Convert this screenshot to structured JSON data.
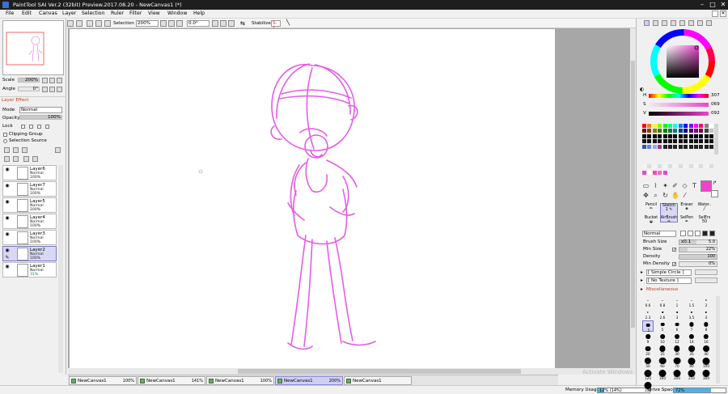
{
  "window": {
    "title": "PaintTool SAI Ver.2 (32bit) Preview.2017.08.20 - NewCanvas1 (*)",
    "min": "–",
    "max": "□",
    "close": "✕"
  },
  "menu": [
    "File",
    "Edit",
    "Canvas",
    "Layer",
    "Selection",
    "Ruler",
    "Filter",
    "View",
    "Window",
    "Help"
  ],
  "toolbar": {
    "selection_label": "Selection",
    "zoom": "200%",
    "angle": "0.0°",
    "stabilizer_label": "Stabilizer",
    "stabilizer_value": "S-1"
  },
  "navigator": {
    "scale_label": "Scale",
    "scale_value": "200%",
    "angle_label": "Angle",
    "angle_value": "0°"
  },
  "layer_panel": {
    "effect_label": "Layer Effect",
    "mode_label": "Mode",
    "mode_value": "Normal",
    "opacity_label": "Opacity",
    "opacity_value": "100%",
    "lock_label": "Lock",
    "clipping_label": "Clipping Group",
    "selection_source_label": "Selection Source",
    "layers": [
      {
        "name": "Layer6",
        "mode": "Normal",
        "opacity": "100%"
      },
      {
        "name": "Layer7",
        "mode": "Normal",
        "opacity": "100%"
      },
      {
        "name": "Layer5",
        "mode": "Normal",
        "opacity": "100%"
      },
      {
        "name": "Layer4",
        "mode": "Normal",
        "opacity": "100%"
      },
      {
        "name": "Layer3",
        "mode": "Normal",
        "opacity": "100%"
      },
      {
        "name": "Layer2",
        "mode": "Normal",
        "opacity": "100%"
      },
      {
        "name": "Layer1",
        "mode": "Normal",
        "opacity": "31%"
      }
    ]
  },
  "canvas_tabs": [
    {
      "name": "NewCanvas1",
      "zoom": "100%"
    },
    {
      "name": "NewCanvas1",
      "zoom": "141%"
    },
    {
      "name": "NewCanvas1",
      "zoom": "100%"
    },
    {
      "name": "NewCanvas1",
      "zoom": "200%"
    },
    {
      "name": "NewCanvas1",
      "zoom": ""
    }
  ],
  "status": {
    "memory_label": "Memory Usage",
    "memory_value": "12% (14%)",
    "memory_fraction": 0.12,
    "drive_label": "Drive Space",
    "drive_value": "72%",
    "drive_fraction": 0.72,
    "activate_text": "Activate Windows"
  },
  "color": {
    "current": "#ee44cc",
    "h_label": "H",
    "h_value": "307",
    "s_label": "S",
    "s_value": "069",
    "v_label": "V",
    "v_value": "092"
  },
  "tools": [
    {
      "name": "Pencil",
      "size": ""
    },
    {
      "name": "Sketch",
      "size": "1"
    },
    {
      "name": "Eraser",
      "size": ""
    },
    {
      "name": "Water..",
      "size": ""
    },
    {
      "name": "Bucket",
      "size": ""
    },
    {
      "name": "AirBrush",
      "size": ""
    },
    {
      "name": "SelPen",
      "size": ""
    },
    {
      "name": "SelErs",
      "size": "50"
    }
  ],
  "brush": {
    "mode_value": "Normal",
    "size_label": "Brush Size",
    "size_mult": "x0.1",
    "size_value": "5.0",
    "minsize_label": "Min Size",
    "minsize_value": "22%",
    "density_label": "Density",
    "density_value": "100",
    "mindensity_label": "Min Density",
    "mindensity_value": "0%",
    "shape_value": "[ Simple Circle ]",
    "texture_value": "[ No Texture ]",
    "misc_label": "Miscellaneous"
  },
  "brush_sizes": [
    "0.6",
    "0.8",
    "1",
    "1.5",
    "2",
    "2.3",
    "2.6",
    "3",
    "3.5",
    "4",
    "5",
    "5",
    "6",
    "7",
    "8",
    "9",
    "10",
    "12",
    "14",
    "16",
    "20",
    "25",
    "30",
    "35",
    "40",
    "50",
    "60",
    "70",
    "80",
    "100",
    "120",
    "160",
    "200",
    "250",
    "300",
    "350"
  ]
}
